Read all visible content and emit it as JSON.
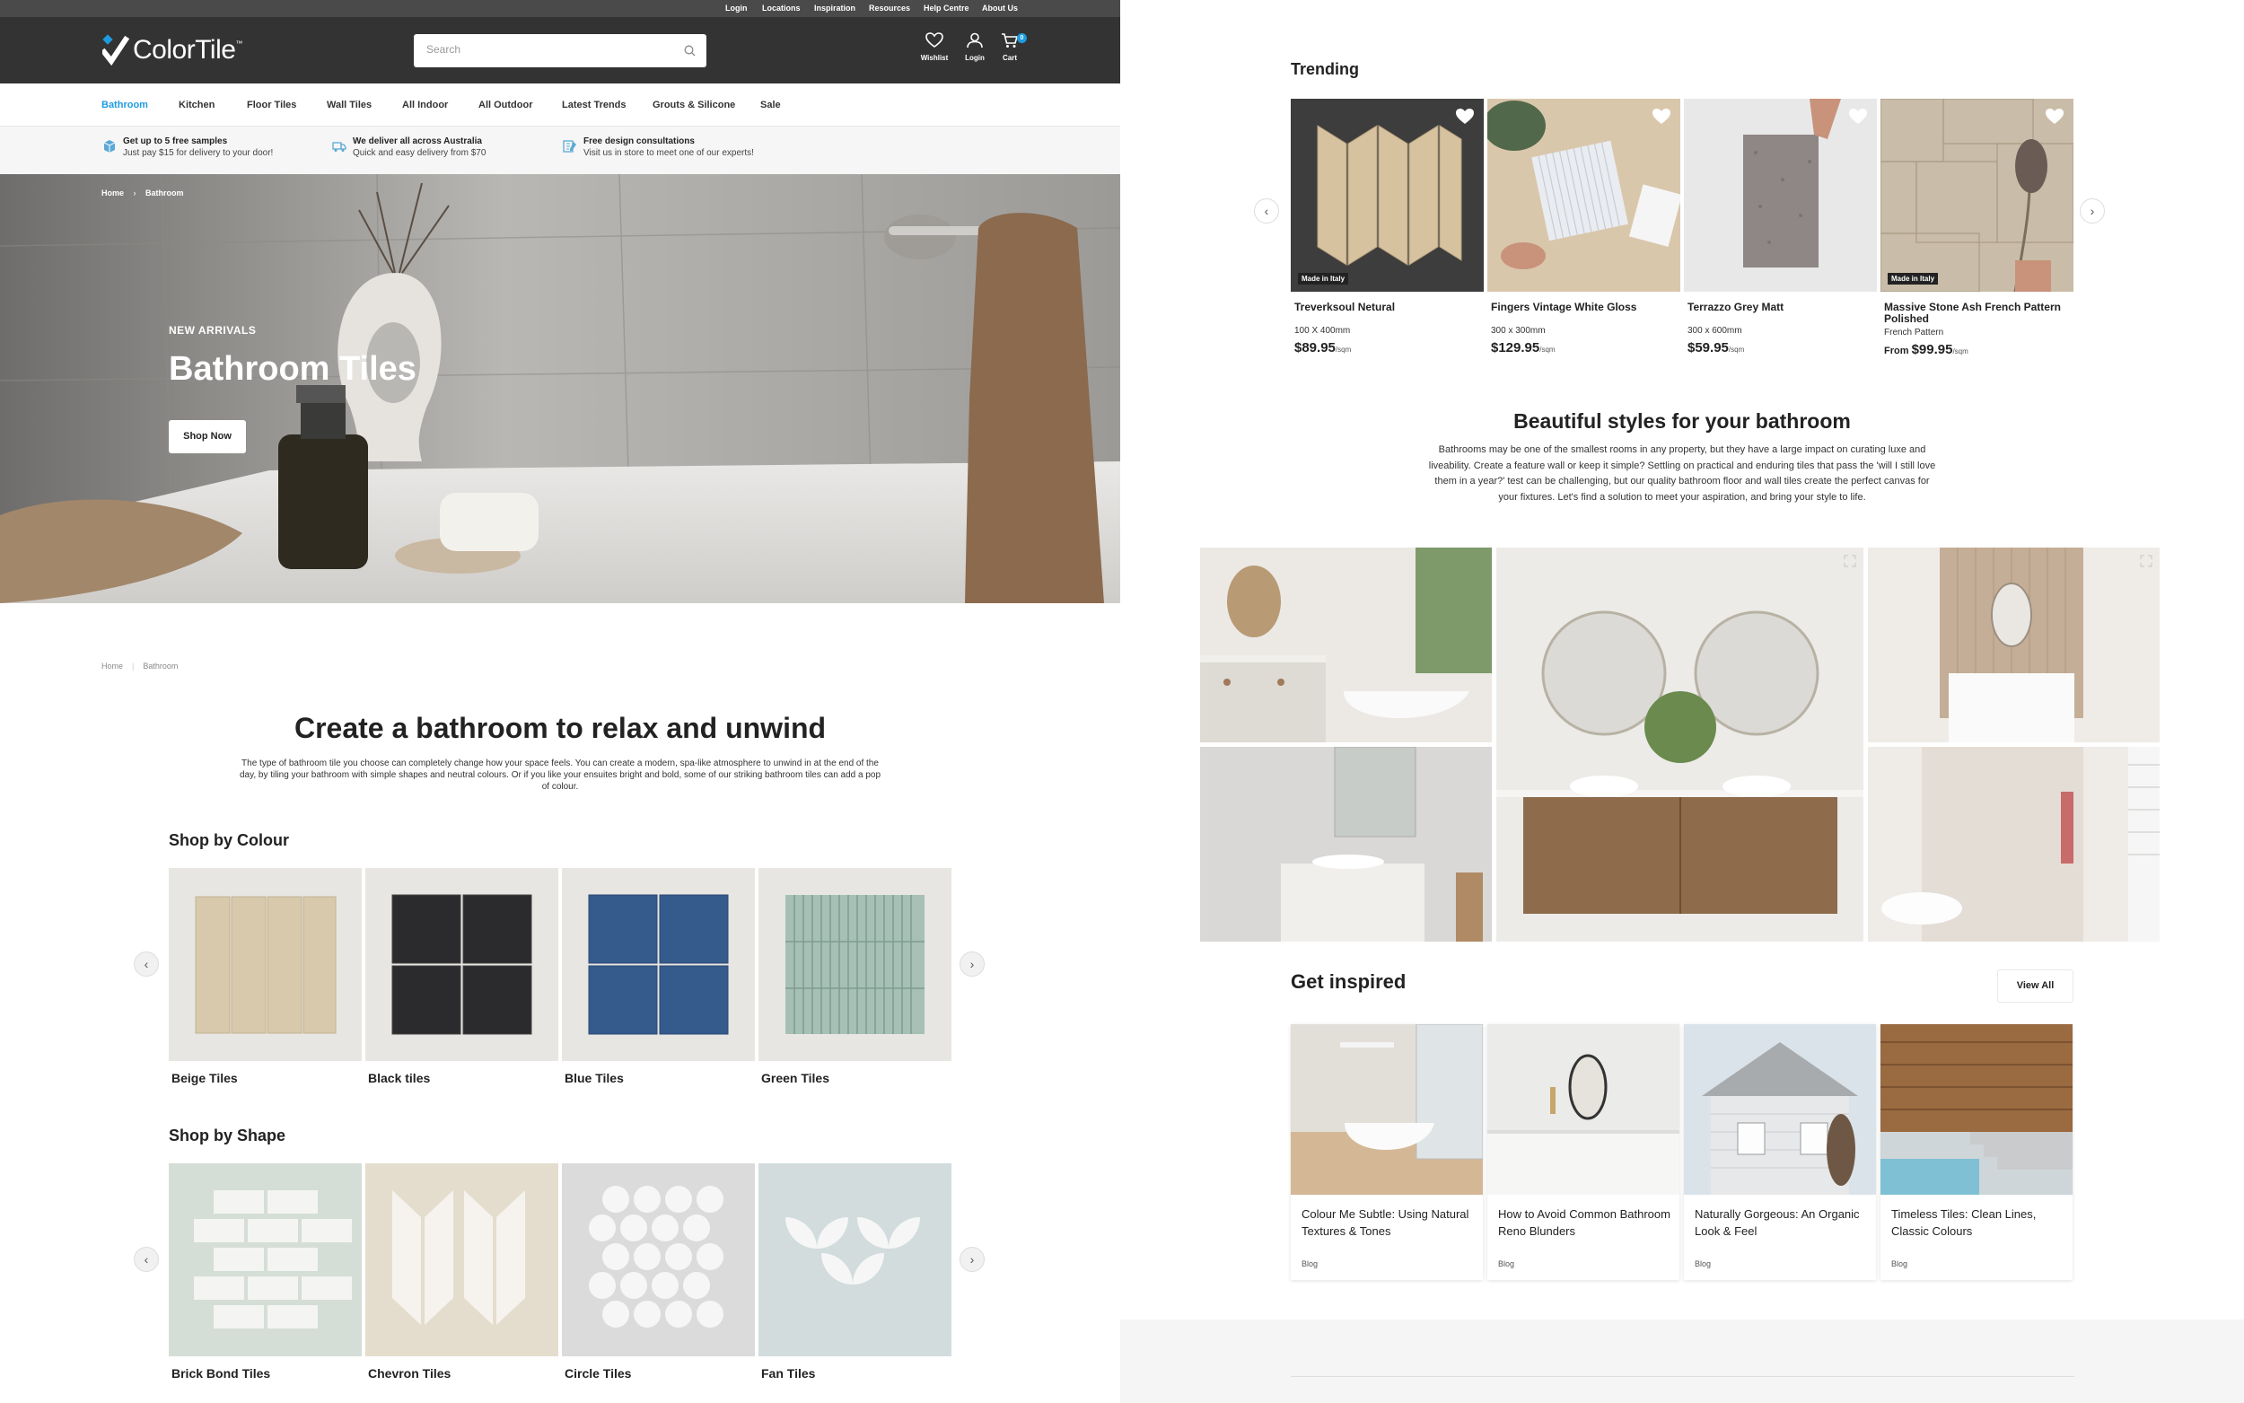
{
  "utility_links": [
    "Login",
    "Locations",
    "Inspiration",
    "Resources",
    "Help Centre",
    "About Us"
  ],
  "logo": {
    "text": "ColorTile",
    "tm": "™"
  },
  "search": {
    "placeholder": "Search"
  },
  "header_icons": {
    "wishlist": "Wishlist",
    "login": "Login",
    "cart": "Cart",
    "cart_count": "0"
  },
  "nav": [
    "Bathroom",
    "Kitchen",
    "Floor Tiles",
    "Wall Tiles",
    "All Indoor",
    "All Outdoor",
    "Latest Trends",
    "Grouts & Silicone",
    "Sale"
  ],
  "promos": [
    {
      "title": "Get up to 5 free samples",
      "sub": "Just pay $15 for delivery to your door!",
      "icon": "box-icon"
    },
    {
      "title": "We deliver all across Australia",
      "sub": "Quick and easy delivery from $70",
      "icon": "truck-icon"
    },
    {
      "title": "Free design consultations",
      "sub": "Visit us in store to meet one of our experts!",
      "icon": "design-icon"
    }
  ],
  "hero": {
    "breadcrumb_home": "Home",
    "breadcrumb_sep": "›",
    "breadcrumb_current": "Bathroom",
    "eyebrow": "NEW ARRIVALS",
    "title": "Bathroom Tiles",
    "button": "Shop Now"
  },
  "breadcrumb": {
    "home": "Home",
    "sep": "|",
    "current": "Bathroom"
  },
  "intro": {
    "title": "Create a bathroom to relax and unwind",
    "text": "The type of bathroom tile you choose can completely change how your space feels. You can create a modern, spa-like atmosphere to unwind in at the end of the day, by tiling your bathroom with simple shapes and neutral colours. Or if you like your ensuites bright and bold, some of our striking bathroom tiles can add a pop of colour."
  },
  "shop_by_colour": {
    "title": "Shop by Colour",
    "items": [
      "Beige Tiles",
      "Black tiles",
      "Blue Tiles",
      "Green Tiles"
    ]
  },
  "shop_by_shape": {
    "title": "Shop by Shape",
    "items": [
      "Brick Bond Tiles",
      "Chevron Tiles",
      "Circle Tiles",
      "Fan Tiles"
    ]
  },
  "arrows": {
    "prev": "‹",
    "next": "›"
  },
  "trending": {
    "title": "Trending",
    "products": [
      {
        "name": "Treverksoul Netural",
        "size": "100 X 400mm",
        "prefix": "",
        "price": "$89.95",
        "unit": "/sqm",
        "badge": "Made in Italy"
      },
      {
        "name": "Fingers Vintage White Gloss",
        "size": "300 x 300mm",
        "prefix": "",
        "price": "$129.95",
        "unit": "/sqm",
        "badge": ""
      },
      {
        "name": "Terrazzo Grey Matt",
        "size": "300 x 600mm",
        "prefix": "",
        "price": "$59.95",
        "unit": "/sqm",
        "badge": ""
      },
      {
        "name": "Massive Stone Ash French Pattern Polished",
        "size": "French Pattern",
        "prefix": "From ",
        "price": "$99.95",
        "unit": "/sqm",
        "badge": "Made in Italy"
      }
    ]
  },
  "beautiful": {
    "title": "Beautiful styles for your bathroom",
    "text": "Bathrooms may be one of the smallest rooms in any property, but they have a large impact on curating luxe and liveability. Create a feature wall or keep it simple? Settling on practical and enduring tiles that pass the 'will I still love them in a year?' test can be challenging, but our quality bathroom floor and wall tiles create the perfect canvas for your fixtures. Let's find a solution to meet your aspiration, and bring your style to life."
  },
  "inspired": {
    "title": "Get inspired",
    "view_all": "View All",
    "posts": [
      {
        "title": "Colour Me Subtle: Using Natural Textures & Tones",
        "tag": "Blog"
      },
      {
        "title": "How to Avoid Common Bathroom Reno Blunders",
        "tag": "Blog"
      },
      {
        "title": "Naturally Gorgeous: An Organic Look & Feel",
        "tag": "Blog"
      },
      {
        "title": "Timeless Tiles: Clean Lines, Classic Colours",
        "tag": "Blog"
      }
    ]
  },
  "colors": {
    "accent": "#1e9be0",
    "header_bg": "#333333",
    "utility_bg": "#4a4a4a"
  }
}
